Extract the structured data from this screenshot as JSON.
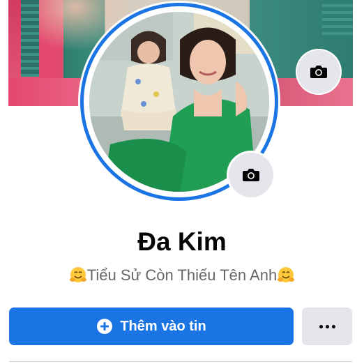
{
  "profile": {
    "name": "Đa Kim",
    "bio": "Tiểu Sử Còn Thiếu Tên Anh",
    "bio_emoji": "hugging-face-emoji"
  },
  "actions": {
    "add_to_story_label": "Thêm vào tin",
    "add_icon": "plus-circle-icon",
    "more_icon": "ellipsis-icon"
  },
  "icons": {
    "cover_camera": "camera-icon",
    "avatar_camera": "camera-icon"
  },
  "colors": {
    "accent": "#1b74e4",
    "secondary_button": "#e4e6eb",
    "name_text": "#050505",
    "bio_text": "#65676b"
  }
}
